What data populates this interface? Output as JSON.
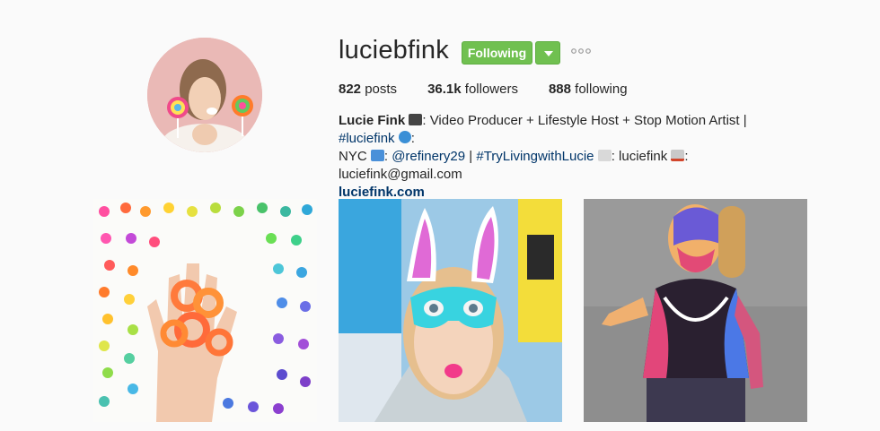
{
  "profile": {
    "username": "luciebfink",
    "following_label": "Following",
    "stats": {
      "posts_count": "822",
      "posts_label": " posts",
      "followers_count": "36.1k",
      "followers_label": " followers",
      "following_count": "888",
      "following_label": " following"
    },
    "bio": {
      "name": "Lucie Fink",
      "line1_rest": ": Video Producer + Lifestyle Host + Stop Motion Artist | ",
      "hashtag1": "#luciefink",
      "line1_end": ":",
      "loc_text": "NYC",
      "sep1": ": ",
      "mention": "@refinery29",
      "pipe": " | ",
      "hashtag2": "#TryLivingwithLucie",
      "snap_text": ": luciefink",
      "email_text": ": luciefink@gmail.com",
      "website": "luciefink.com"
    }
  },
  "icons": {
    "dropdown": "chevron-down-icon",
    "more": "ellipsis-icon",
    "emoji_camera": "movie-camera-icon",
    "emoji_globe": "globe-icon",
    "emoji_play": "play-button-icon",
    "emoji_ghost": "ghost-icon",
    "emoji_inbox": "inbox-icon"
  },
  "colors": {
    "accent_green": "#70c050",
    "link_blue": "#003569",
    "background": "#fafafa"
  }
}
